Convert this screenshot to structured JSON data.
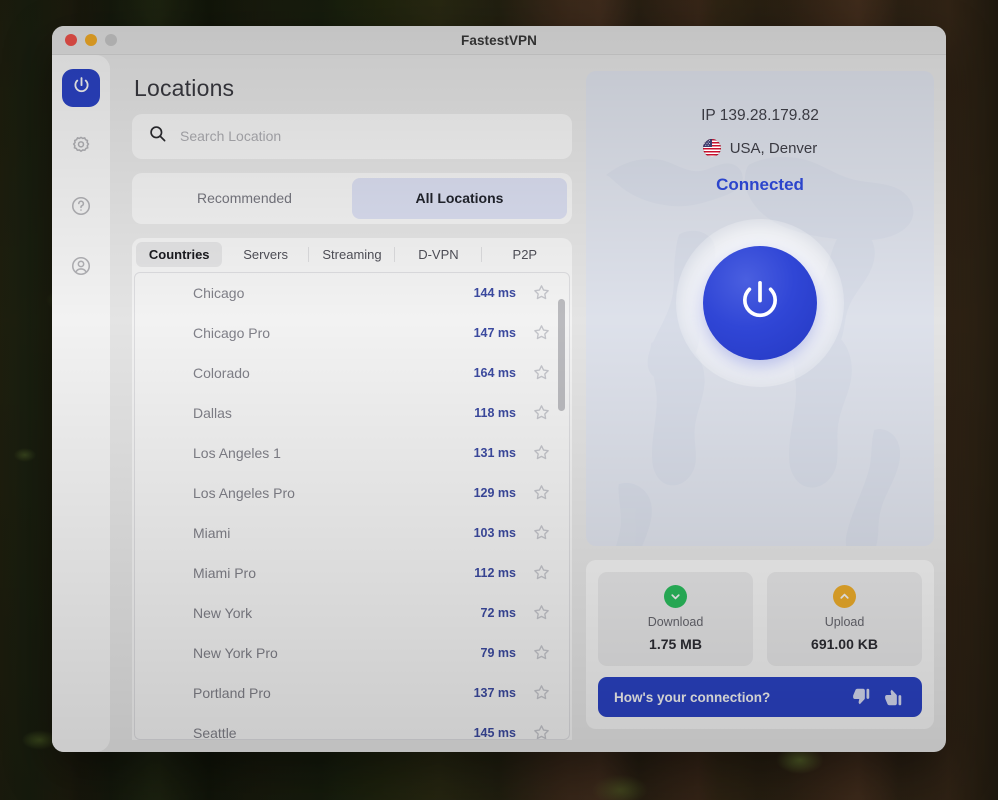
{
  "window": {
    "title": "FastestVPN",
    "controls": [
      {
        "name": "close",
        "color": "#f9554e"
      },
      {
        "name": "minimize",
        "color": "#fcb228"
      },
      {
        "name": "maximize",
        "color": "#cfcfcf"
      }
    ]
  },
  "sidebar": {
    "items": [
      {
        "name": "power",
        "icon": "power-icon",
        "active": true
      },
      {
        "name": "settings",
        "icon": "gear-icon",
        "active": false
      },
      {
        "name": "help",
        "icon": "question-circle-icon",
        "active": false
      },
      {
        "name": "account",
        "icon": "user-circle-icon",
        "active": false
      }
    ]
  },
  "locations": {
    "title": "Locations",
    "search": {
      "value": "",
      "placeholder": "Search Location",
      "icon": "search-icon"
    },
    "segments": [
      {
        "label": "Recommended",
        "active": false
      },
      {
        "label": "All Locations",
        "active": true
      }
    ],
    "tabs": [
      {
        "label": "Countries",
        "active": true
      },
      {
        "label": "Servers",
        "active": false
      },
      {
        "label": "Streaming",
        "active": false
      },
      {
        "label": "D-VPN",
        "active": false
      },
      {
        "label": "P2P",
        "active": false
      }
    ],
    "rows": [
      {
        "name": "Chicago",
        "latency": "144 ms",
        "favorite": false
      },
      {
        "name": "Chicago Pro",
        "latency": "147 ms",
        "favorite": false
      },
      {
        "name": "Colorado",
        "latency": "164 ms",
        "favorite": false
      },
      {
        "name": "Dallas",
        "latency": "118 ms",
        "favorite": false
      },
      {
        "name": "Los Angeles 1",
        "latency": "131 ms",
        "favorite": false
      },
      {
        "name": "Los Angeles Pro",
        "latency": "129 ms",
        "favorite": false
      },
      {
        "name": "Miami",
        "latency": "103 ms",
        "favorite": false
      },
      {
        "name": "Miami Pro",
        "latency": "112 ms",
        "favorite": false
      },
      {
        "name": "New York",
        "latency": "72 ms",
        "favorite": false
      },
      {
        "name": "New York Pro",
        "latency": "79 ms",
        "favorite": false
      },
      {
        "name": "Portland Pro",
        "latency": "137 ms",
        "favorite": false
      },
      {
        "name": "Seattle",
        "latency": "145 ms",
        "favorite": false
      }
    ]
  },
  "connection": {
    "ip_label": "IP 139.28.179.82",
    "location": "USA, Denver",
    "flag": "us-flag-icon",
    "status": "Connected",
    "status_color": "#2c45cc",
    "power_button": "power-icon"
  },
  "stats": {
    "download": {
      "label": "Download",
      "value": "1.75 MB",
      "icon": "chevron-down-icon",
      "color": "#2cc361"
    },
    "upload": {
      "label": "Upload",
      "value": "691.00 KB",
      "icon": "chevron-up-icon",
      "color": "#f6b32c"
    }
  },
  "feedback": {
    "prompt": "How's your connection?",
    "thumbs_down": "thumbs-down-icon",
    "thumbs_up": "thumbs-up-icon",
    "background": "#2c45cc"
  }
}
